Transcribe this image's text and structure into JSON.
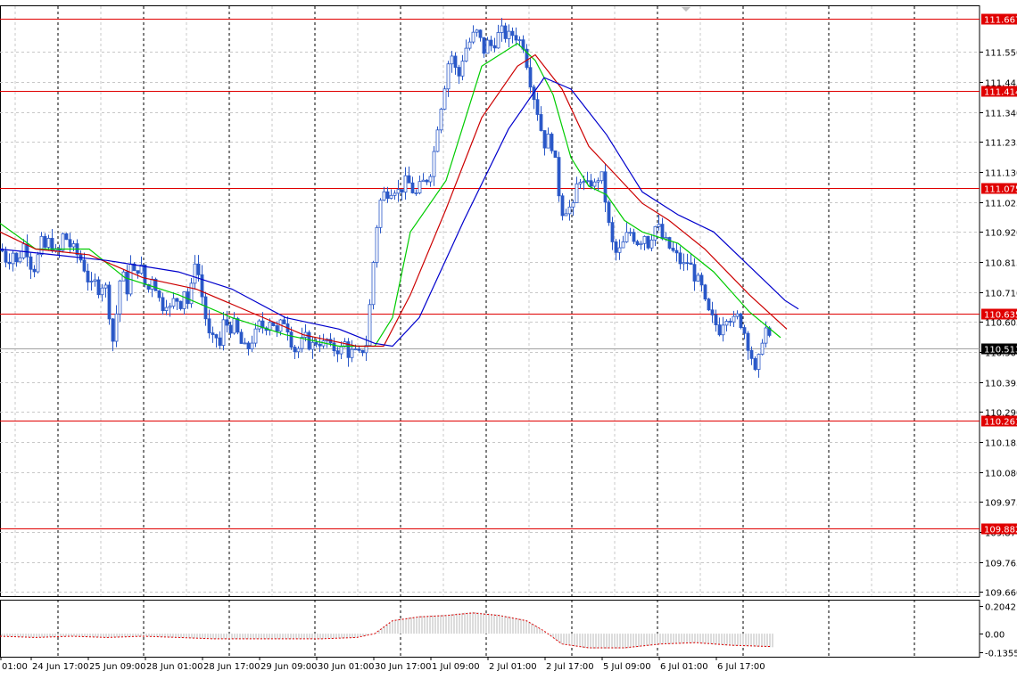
{
  "chart_data": [
    {
      "type": "candlestick",
      "title": "",
      "price_scale": {
        "ticks": [
          "111.550",
          "111.445",
          "111.340",
          "111.235",
          "111.130",
          "111.025",
          "110.920",
          "110.815",
          "110.710",
          "110.605",
          "110.500",
          "110.395",
          "110.290",
          "110.185",
          "110.080",
          "109.975",
          "109.870",
          "109.765",
          "109.660"
        ],
        "ylim": [
          109.645,
          111.71
        ],
        "current_price": "110.513"
      },
      "horizontal_levels": [
        {
          "label": "111.667",
          "value": 111.667
        },
        {
          "label": "111.414",
          "value": 111.414
        },
        {
          "label": "111.075",
          "value": 111.075
        },
        {
          "label": "110.635",
          "value": 110.635
        },
        {
          "label": "110.261",
          "value": 110.261
        },
        {
          "label": "109.882",
          "value": 109.882
        }
      ],
      "time_labels": [
        "01:00",
        "24 Jun 17:00",
        "25 Jun 09:00",
        "28 Jun 01:00",
        "28 Jun 17:00",
        "29 Jun 09:00",
        "30 Jun 01:00",
        "30 Jun 17:00",
        "1 Jul 09:00",
        "2 Jul 01:00",
        "2 Jul 17:00",
        "5 Jul 09:00",
        "6 Jul 01:00",
        "6 Jul 17:00"
      ],
      "close_path": [
        [
          0,
          110.86
        ],
        [
          6,
          110.82
        ],
        [
          12,
          110.84
        ],
        [
          15,
          110.87
        ],
        [
          16,
          110.8
        ],
        [
          20,
          110.83
        ],
        [
          24,
          110.88
        ],
        [
          30,
          110.85
        ],
        [
          35,
          110.78
        ],
        [
          40,
          110.82
        ],
        [
          45,
          110.88
        ],
        [
          50,
          110.86
        ],
        [
          55,
          110.9
        ],
        [
          60,
          110.84
        ],
        [
          65,
          110.85
        ],
        [
          70,
          110.92
        ],
        [
          75,
          110.88
        ],
        [
          80,
          110.86
        ],
        [
          85,
          110.84
        ],
        [
          90,
          110.82
        ],
        [
          95,
          110.78
        ],
        [
          100,
          110.72
        ],
        [
          105,
          110.74
        ],
        [
          110,
          110.72
        ],
        [
          115,
          110.75
        ],
        [
          120,
          110.68
        ],
        [
          124,
          110.52
        ],
        [
          128,
          110.6
        ],
        [
          132,
          110.74
        ],
        [
          136,
          110.78
        ],
        [
          140,
          110.7
        ],
        [
          145,
          110.8
        ],
        [
          150,
          110.76
        ],
        [
          155,
          110.82
        ],
        [
          160,
          110.74
        ],
        [
          165,
          110.72
        ],
        [
          170,
          110.78
        ],
        [
          175,
          110.7
        ],
        [
          180,
          110.66
        ],
        [
          185,
          110.68
        ],
        [
          190,
          110.64
        ],
        [
          195,
          110.7
        ],
        [
          200,
          110.66
        ],
        [
          205,
          110.72
        ],
        [
          210,
          110.66
        ],
        [
          215,
          110.76
        ],
        [
          218,
          110.86
        ],
        [
          222,
          110.74
        ],
        [
          226,
          110.68
        ],
        [
          230,
          110.6
        ],
        [
          235,
          110.52
        ],
        [
          240,
          110.56
        ],
        [
          245,
          110.52
        ],
        [
          250,
          110.62
        ],
        [
          255,
          110.58
        ],
        [
          260,
          110.6
        ],
        [
          265,
          110.56
        ],
        [
          270,
          110.52
        ],
        [
          275,
          110.5
        ],
        [
          280,
          110.54
        ],
        [
          285,
          110.56
        ],
        [
          290,
          110.6
        ],
        [
          295,
          110.58
        ],
        [
          300,
          110.62
        ],
        [
          305,
          110.6
        ],
        [
          310,
          110.55
        ],
        [
          315,
          110.62
        ],
        [
          320,
          110.6
        ],
        [
          325,
          110.54
        ],
        [
          330,
          110.5
        ],
        [
          335,
          110.52
        ],
        [
          340,
          110.55
        ],
        [
          345,
          110.53
        ],
        [
          350,
          110.52
        ],
        [
          355,
          110.55
        ],
        [
          360,
          110.52
        ],
        [
          365,
          110.54
        ],
        [
          370,
          110.5
        ],
        [
          375,
          110.52
        ],
        [
          380,
          110.5
        ],
        [
          385,
          110.53
        ],
        [
          390,
          110.49
        ],
        [
          395,
          110.5
        ],
        [
          400,
          110.48
        ],
        [
          405,
          110.51
        ],
        [
          408,
          110.5
        ],
        [
          412,
          110.62
        ],
        [
          416,
          110.78
        ],
        [
          420,
          110.92
        ],
        [
          424,
          111.02
        ],
        [
          428,
          111.05
        ],
        [
          432,
          111.06
        ],
        [
          436,
          111.07
        ],
        [
          440,
          111.08
        ],
        [
          445,
          111.06
        ],
        [
          450,
          111.08
        ],
        [
          455,
          111.1
        ],
        [
          460,
          111.07
        ],
        [
          465,
          111.05
        ],
        [
          470,
          111.08
        ],
        [
          475,
          111.1
        ],
        [
          480,
          111.12
        ],
        [
          485,
          111.2
        ],
        [
          488,
          111.28
        ],
        [
          492,
          111.35
        ],
        [
          496,
          111.42
        ],
        [
          500,
          111.5
        ],
        [
          504,
          111.55
        ],
        [
          508,
          111.5
        ],
        [
          512,
          111.45
        ],
        [
          516,
          111.52
        ],
        [
          520,
          111.56
        ],
        [
          524,
          111.58
        ],
        [
          528,
          111.6
        ],
        [
          532,
          111.62
        ],
        [
          536,
          111.6
        ],
        [
          540,
          111.55
        ],
        [
          545,
          111.58
        ],
        [
          550,
          111.57
        ],
        [
          555,
          111.6
        ],
        [
          560,
          111.62
        ],
        [
          565,
          111.61
        ],
        [
          570,
          111.6
        ],
        [
          575,
          111.62
        ],
        [
          580,
          111.59
        ],
        [
          585,
          111.58
        ],
        [
          590,
          111.5
        ],
        [
          595,
          111.42
        ],
        [
          600,
          111.36
        ],
        [
          605,
          111.28
        ],
        [
          610,
          111.22
        ],
        [
          615,
          111.26
        ],
        [
          620,
          111.18
        ],
        [
          625,
          111.06
        ],
        [
          630,
          110.98
        ],
        [
          635,
          111.02
        ],
        [
          640,
          110.98
        ],
        [
          645,
          111.08
        ],
        [
          650,
          111.12
        ],
        [
          655,
          111.06
        ],
        [
          660,
          111.1
        ],
        [
          665,
          111.08
        ],
        [
          670,
          111.12
        ],
        [
          675,
          111.1
        ],
        [
          678,
          111.0
        ],
        [
          682,
          110.92
        ],
        [
          686,
          110.86
        ],
        [
          690,
          110.84
        ],
        [
          695,
          110.86
        ],
        [
          700,
          110.9
        ],
        [
          705,
          110.92
        ],
        [
          710,
          110.9
        ],
        [
          715,
          110.88
        ],
        [
          720,
          110.92
        ],
        [
          725,
          110.88
        ],
        [
          730,
          110.92
        ],
        [
          735,
          110.95
        ],
        [
          740,
          110.9
        ],
        [
          745,
          110.88
        ],
        [
          750,
          110.86
        ],
        [
          755,
          110.84
        ],
        [
          760,
          110.82
        ],
        [
          765,
          110.8
        ],
        [
          770,
          110.82
        ],
        [
          775,
          110.78
        ],
        [
          780,
          110.75
        ],
        [
          785,
          110.72
        ],
        [
          790,
          110.65
        ],
        [
          795,
          110.62
        ],
        [
          800,
          110.6
        ],
        [
          805,
          110.58
        ],
        [
          810,
          110.62
        ],
        [
          815,
          110.64
        ],
        [
          820,
          110.6
        ],
        [
          825,
          110.62
        ],
        [
          830,
          110.6
        ],
        [
          835,
          110.55
        ],
        [
          840,
          110.5
        ],
        [
          845,
          110.42
        ],
        [
          850,
          110.48
        ],
        [
          855,
          110.6
        ],
        [
          860,
          110.55
        ],
        [
          863,
          110.51
        ]
      ],
      "moving_averages": [
        {
          "color": "#00cc00",
          "points": [
            [
              0,
              110.95
            ],
            [
              40,
              110.86
            ],
            [
              100,
              110.86
            ],
            [
              140,
              110.76
            ],
            [
              200,
              110.7
            ],
            [
              260,
              110.62
            ],
            [
              320,
              110.56
            ],
            [
              380,
              110.52
            ],
            [
              420,
              110.52
            ],
            [
              440,
              110.62
            ],
            [
              460,
              110.92
            ],
            [
              500,
              111.1
            ],
            [
              520,
              111.3
            ],
            [
              540,
              111.5
            ],
            [
              580,
              111.58
            ],
            [
              600,
              111.52
            ],
            [
              620,
              111.4
            ],
            [
              640,
              111.18
            ],
            [
              660,
              111.08
            ],
            [
              680,
              111.05
            ],
            [
              700,
              110.96
            ],
            [
              720,
              110.92
            ],
            [
              760,
              110.88
            ],
            [
              800,
              110.78
            ],
            [
              840,
              110.64
            ],
            [
              875,
              110.55
            ]
          ]
        },
        {
          "color": "#cc0000",
          "points": [
            [
              0,
              110.92
            ],
            [
              40,
              110.86
            ],
            [
              100,
              110.84
            ],
            [
              160,
              110.76
            ],
            [
              220,
              110.72
            ],
            [
              280,
              110.64
            ],
            [
              340,
              110.56
            ],
            [
              400,
              110.52
            ],
            [
              430,
              110.52
            ],
            [
              460,
              110.7
            ],
            [
              500,
              111.0
            ],
            [
              540,
              111.32
            ],
            [
              580,
              111.5
            ],
            [
              600,
              111.54
            ],
            [
              630,
              111.42
            ],
            [
              660,
              111.22
            ],
            [
              690,
              111.12
            ],
            [
              720,
              111.02
            ],
            [
              750,
              110.96
            ],
            [
              790,
              110.86
            ],
            [
              840,
              110.7
            ],
            [
              882,
              110.58
            ]
          ]
        },
        {
          "color": "#0000cc",
          "points": [
            [
              0,
              110.86
            ],
            [
              60,
              110.84
            ],
            [
              120,
              110.82
            ],
            [
              200,
              110.78
            ],
            [
              260,
              110.72
            ],
            [
              320,
              110.62
            ],
            [
              380,
              110.58
            ],
            [
              420,
              110.53
            ],
            [
              440,
              110.52
            ],
            [
              470,
              110.62
            ],
            [
              520,
              110.96
            ],
            [
              570,
              111.28
            ],
            [
              610,
              111.46
            ],
            [
              640,
              111.42
            ],
            [
              680,
              111.26
            ],
            [
              720,
              111.06
            ],
            [
              760,
              110.98
            ],
            [
              800,
              110.92
            ],
            [
              840,
              110.8
            ],
            [
              880,
              110.68
            ],
            [
              895,
              110.65
            ]
          ]
        }
      ]
    },
    {
      "type": "histogram",
      "title": "",
      "price_scale": {
        "ticks": [
          "0.2042",
          "0.00",
          "-0.1355"
        ],
        "ylim": [
          -0.17,
          0.25
        ]
      },
      "bars": [
        [
          0,
          -0.02
        ],
        [
          40,
          -0.03
        ],
        [
          80,
          -0.02
        ],
        [
          120,
          -0.03
        ],
        [
          160,
          -0.02
        ],
        [
          200,
          -0.03
        ],
        [
          240,
          -0.04
        ],
        [
          280,
          -0.04
        ],
        [
          320,
          -0.04
        ],
        [
          360,
          -0.04
        ],
        [
          400,
          -0.03
        ],
        [
          420,
          0.0
        ],
        [
          440,
          0.1
        ],
        [
          470,
          0.13
        ],
        [
          500,
          0.14
        ],
        [
          530,
          0.16
        ],
        [
          560,
          0.14
        ],
        [
          590,
          0.1
        ],
        [
          610,
          0.02
        ],
        [
          630,
          -0.08
        ],
        [
          660,
          -0.11
        ],
        [
          700,
          -0.11
        ],
        [
          740,
          -0.08
        ],
        [
          780,
          -0.07
        ],
        [
          820,
          -0.09
        ],
        [
          865,
          -0.1
        ]
      ]
    }
  ]
}
